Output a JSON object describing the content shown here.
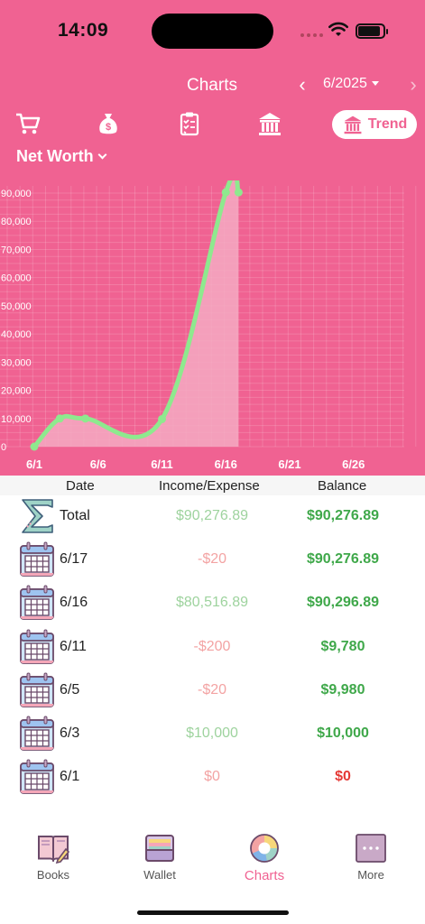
{
  "status_bar": {
    "time": "14:09"
  },
  "header": {
    "title": "Charts",
    "month": "6/2025"
  },
  "category_tabs": [
    {
      "icon": "cart-icon"
    },
    {
      "icon": "money-bag-icon"
    },
    {
      "icon": "clipboard-icon"
    },
    {
      "icon": "bank-icon"
    },
    {
      "icon": "bank-icon",
      "label": "Trend",
      "selected": true
    }
  ],
  "metric_selector": {
    "label": "Net Worth"
  },
  "chart_data": {
    "type": "area",
    "x": [
      "6/1",
      "6/3",
      "6/5",
      "6/11",
      "6/16",
      "6/17"
    ],
    "x_ticks": [
      "6/1",
      "6/6",
      "6/11",
      "6/16",
      "6/21",
      "6/26"
    ],
    "y_ticks": [
      "0",
      "10,000",
      "20,000",
      "30,000",
      "40,000",
      "50,000",
      "60,000",
      "70,000",
      "80,000",
      "90,000"
    ],
    "values": [
      0,
      10000,
      9980,
      9780,
      90296.89,
      90276.89
    ],
    "ylim": [
      0,
      90000
    ],
    "grid": true,
    "colors": {
      "line": "#8ee98e",
      "fill": "#f5aac2",
      "background": "#f06292"
    }
  },
  "table": {
    "headers": {
      "date": "Date",
      "income_expense": "Income/Expense",
      "balance": "Balance"
    },
    "rows": [
      {
        "label": "Total",
        "icon": "sigma-icon",
        "amount": "$90,276.89",
        "amount_sign": "pos",
        "balance": "$90,276.89",
        "balance_sign": "pos"
      },
      {
        "label": "6/17",
        "icon": "calendar-icon",
        "amount": "-$20",
        "amount_sign": "neg",
        "balance": "$90,276.89",
        "balance_sign": "pos"
      },
      {
        "label": "6/16",
        "icon": "calendar-icon",
        "amount": "$80,516.89",
        "amount_sign": "pos",
        "balance": "$90,296.89",
        "balance_sign": "pos"
      },
      {
        "label": "6/11",
        "icon": "calendar-icon",
        "amount": "-$200",
        "amount_sign": "neg",
        "balance": "$9,780",
        "balance_sign": "pos"
      },
      {
        "label": "6/5",
        "icon": "calendar-icon",
        "amount": "-$20",
        "amount_sign": "neg",
        "balance": "$9,980",
        "balance_sign": "pos"
      },
      {
        "label": "6/3",
        "icon": "calendar-icon",
        "amount": "$10,000",
        "amount_sign": "pos",
        "balance": "$10,000",
        "balance_sign": "pos"
      },
      {
        "label": "6/1",
        "icon": "calendar-icon",
        "amount": "$0",
        "amount_sign": "neg",
        "balance": "$0",
        "balance_sign": "neg"
      }
    ]
  },
  "tab_bar": [
    {
      "label": "Books",
      "icon": "book-icon"
    },
    {
      "label": "Wallet",
      "icon": "wallet-icon"
    },
    {
      "label": "Charts",
      "icon": "pie-chart-icon",
      "active": true
    },
    {
      "label": "More",
      "icon": "more-icon"
    }
  ]
}
